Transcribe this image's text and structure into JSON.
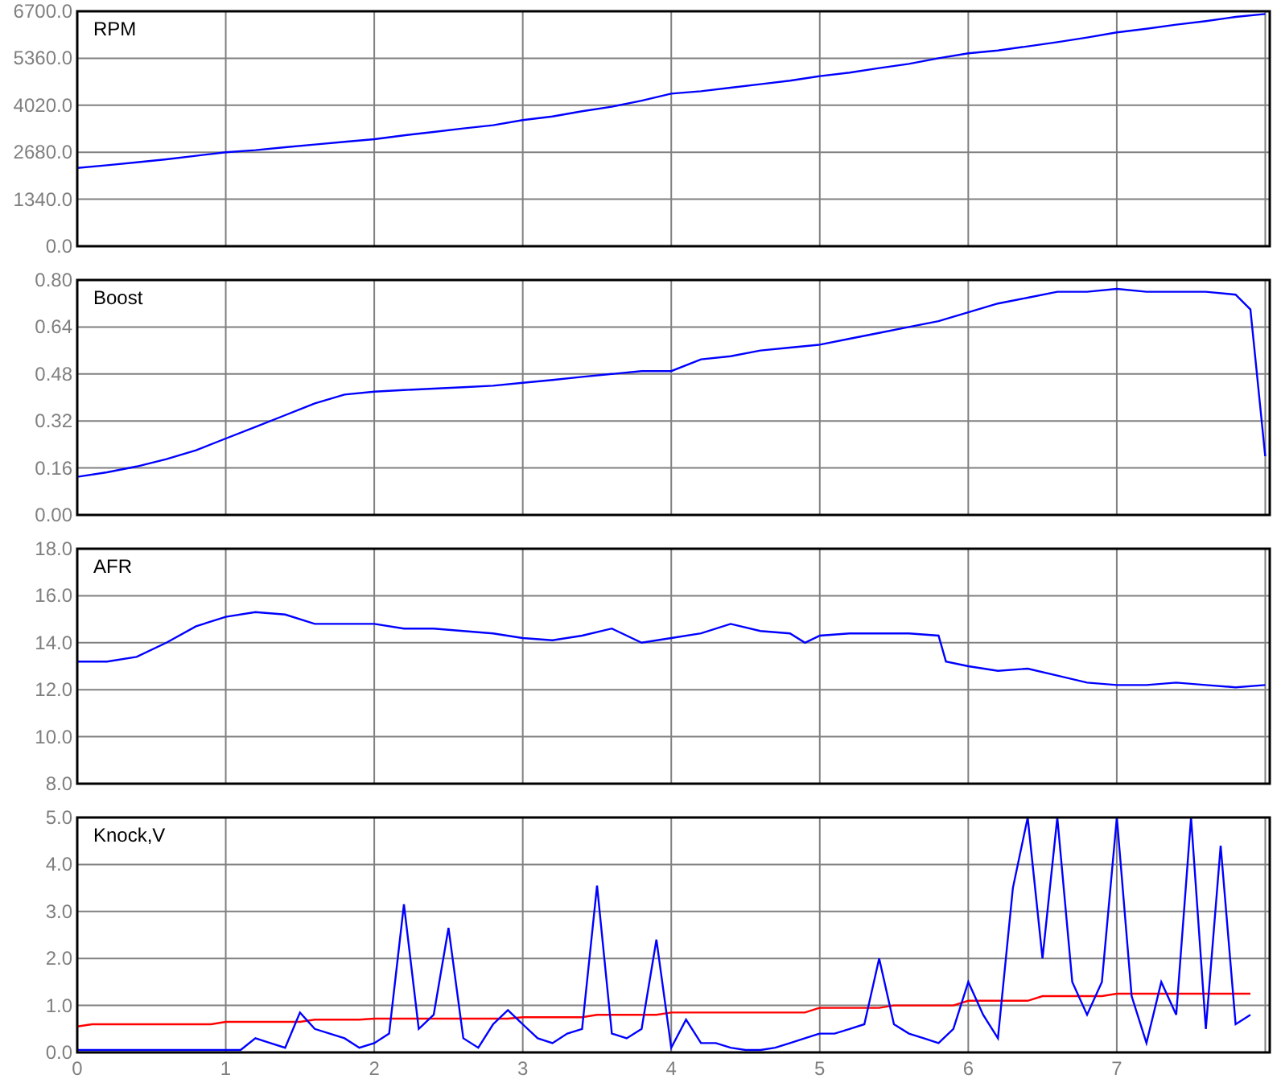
{
  "charts": [
    {
      "chart_data": {
        "type": "line",
        "title": "RPM",
        "grid": true,
        "xlim": [
          0,
          8.03
        ],
        "ylim": [
          0,
          6700
        ],
        "yticks": [
          {
            "value": 0,
            "label": "0.0"
          },
          {
            "value": 1340,
            "label": "1340.0"
          },
          {
            "value": 2680,
            "label": "2680.0"
          },
          {
            "value": 4020,
            "label": "4020.0"
          },
          {
            "value": 5360,
            "label": "5360.0"
          },
          {
            "value": 6700,
            "label": "6700.0"
          }
        ],
        "x": [
          0,
          0.2,
          0.4,
          0.6,
          0.8,
          1,
          1.2,
          1.4,
          1.6,
          1.8,
          2,
          2.2,
          2.4,
          2.6,
          2.8,
          3,
          3.2,
          3.4,
          3.6,
          3.8,
          4,
          4.2,
          4.4,
          4.6,
          4.8,
          5,
          5.2,
          5.4,
          5.6,
          5.8,
          6,
          6.2,
          6.4,
          6.6,
          6.8,
          7,
          7.2,
          7.4,
          7.6,
          7.8,
          8
        ],
        "series": [
          {
            "color": "#0000ff",
            "values": [
              2230,
              2310,
              2390,
              2480,
              2580,
              2680,
              2740,
              2820,
              2900,
              2980,
              3050,
              3160,
              3260,
              3360,
              3450,
              3600,
              3700,
              3850,
              3980,
              4150,
              4350,
              4420,
              4520,
              4620,
              4720,
              4850,
              4950,
              5080,
              5200,
              5360,
              5500,
              5580,
              5700,
              5820,
              5950,
              6100,
              6200,
              6320,
              6420,
              6540,
              6620
            ]
          }
        ]
      }
    },
    {
      "chart_data": {
        "type": "line",
        "title": "Boost",
        "grid": true,
        "xlim": [
          0,
          8.03
        ],
        "ylim": [
          0,
          0.8
        ],
        "yticks": [
          {
            "value": 0,
            "label": "0.00"
          },
          {
            "value": 0.16,
            "label": "0.16"
          },
          {
            "value": 0.32,
            "label": "0.32"
          },
          {
            "value": 0.48,
            "label": "0.48"
          },
          {
            "value": 0.64,
            "label": "0.64"
          },
          {
            "value": 0.8,
            "label": "0.80"
          }
        ],
        "x": [
          0,
          0.2,
          0.4,
          0.6,
          0.8,
          1,
          1.2,
          1.4,
          1.6,
          1.8,
          2,
          2.2,
          2.4,
          2.6,
          2.8,
          3,
          3.2,
          3.4,
          3.6,
          3.8,
          4,
          4.2,
          4.4,
          4.6,
          4.8,
          5,
          5.2,
          5.4,
          5.6,
          5.8,
          6,
          6.2,
          6.4,
          6.6,
          6.8,
          7,
          7.2,
          7.4,
          7.6,
          7.8,
          7.9,
          8
        ],
        "series": [
          {
            "color": "#0000ff",
            "values": [
              0.13,
              0.145,
              0.165,
              0.19,
              0.22,
              0.26,
              0.3,
              0.34,
              0.38,
              0.41,
              0.42,
              0.425,
              0.43,
              0.435,
              0.44,
              0.45,
              0.46,
              0.47,
              0.48,
              0.49,
              0.49,
              0.53,
              0.54,
              0.56,
              0.57,
              0.58,
              0.6,
              0.62,
              0.64,
              0.66,
              0.69,
              0.72,
              0.74,
              0.76,
              0.76,
              0.77,
              0.76,
              0.76,
              0.76,
              0.75,
              0.7,
              0.2
            ]
          }
        ]
      }
    },
    {
      "chart_data": {
        "type": "line",
        "title": "AFR",
        "grid": true,
        "xlim": [
          0,
          8.03
        ],
        "ylim": [
          8,
          18
        ],
        "yticks": [
          {
            "value": 8,
            "label": "8.0"
          },
          {
            "value": 10,
            "label": "10.0"
          },
          {
            "value": 12,
            "label": "12.0"
          },
          {
            "value": 14,
            "label": "14.0"
          },
          {
            "value": 16,
            "label": "16.0"
          },
          {
            "value": 18,
            "label": "18.0"
          }
        ],
        "x": [
          0,
          0.2,
          0.4,
          0.6,
          0.8,
          1,
          1.2,
          1.4,
          1.6,
          1.8,
          2,
          2.2,
          2.4,
          2.6,
          2.8,
          3,
          3.2,
          3.4,
          3.6,
          3.8,
          4,
          4.2,
          4.4,
          4.6,
          4.8,
          4.9,
          5,
          5.2,
          5.4,
          5.6,
          5.8,
          5.85,
          6,
          6.2,
          6.4,
          6.6,
          6.8,
          7,
          7.2,
          7.4,
          7.6,
          7.8,
          8
        ],
        "series": [
          {
            "color": "#0000ff",
            "values": [
              13.2,
              13.2,
              13.4,
              14,
              14.7,
              15.1,
              15.3,
              15.2,
              14.8,
              14.8,
              14.8,
              14.6,
              14.6,
              14.5,
              14.4,
              14.2,
              14.1,
              14.3,
              14.6,
              14,
              14.2,
              14.4,
              14.8,
              14.5,
              14.4,
              14,
              14.3,
              14.4,
              14.4,
              14.4,
              14.3,
              13.2,
              13,
              12.8,
              12.9,
              12.6,
              12.3,
              12.2,
              12.2,
              12.3,
              12.2,
              12.1,
              12.2
            ]
          }
        ]
      }
    },
    {
      "chart_data": {
        "type": "line",
        "title": "Knock,V",
        "grid": true,
        "xlim": [
          0,
          8.03
        ],
        "ylim": [
          0,
          5
        ],
        "xticks": [
          0,
          1,
          2,
          3,
          4,
          5,
          6,
          7
        ],
        "yticks": [
          {
            "value": 0,
            "label": "0.0"
          },
          {
            "value": 1,
            "label": "1.0"
          },
          {
            "value": 2,
            "label": "2.0"
          },
          {
            "value": 3,
            "label": "3.0"
          },
          {
            "value": 4,
            "label": "4.0"
          },
          {
            "value": 5,
            "label": "5.0"
          }
        ],
        "x": [
          0,
          0.1,
          0.2,
          0.3,
          0.4,
          0.5,
          0.6,
          0.7,
          0.8,
          0.9,
          1,
          1.1,
          1.2,
          1.3,
          1.4,
          1.5,
          1.6,
          1.7,
          1.8,
          1.9,
          2,
          2.1,
          2.2,
          2.3,
          2.4,
          2.5,
          2.6,
          2.7,
          2.8,
          2.9,
          3,
          3.1,
          3.2,
          3.3,
          3.4,
          3.5,
          3.6,
          3.7,
          3.8,
          3.9,
          4,
          4.1,
          4.2,
          4.3,
          4.4,
          4.5,
          4.6,
          4.7,
          4.8,
          4.9,
          5,
          5.1,
          5.2,
          5.3,
          5.4,
          5.5,
          5.6,
          5.7,
          5.8,
          5.9,
          6,
          6.1,
          6.2,
          6.3,
          6.4,
          6.5,
          6.6,
          6.7,
          6.8,
          6.9,
          7,
          7.1,
          7.2,
          7.3,
          7.4,
          7.5,
          7.6,
          7.7,
          7.8,
          7.9
        ],
        "series": [
          {
            "color": "#0000ff",
            "values": [
              0.05,
              0.05,
              0.05,
              0.05,
              0.05,
              0.05,
              0.05,
              0.05,
              0.05,
              0.05,
              0.05,
              0.05,
              0.3,
              0.2,
              0.1,
              0.85,
              0.5,
              0.4,
              0.3,
              0.1,
              0.2,
              0.4,
              3.15,
              0.5,
              0.8,
              2.65,
              0.3,
              0.1,
              0.6,
              0.9,
              0.6,
              0.3,
              0.2,
              0.4,
              0.5,
              3.55,
              0.4,
              0.3,
              0.5,
              2.4,
              0.1,
              0.7,
              0.2,
              0.2,
              0.1,
              0.05,
              0.05,
              0.1,
              0.2,
              0.3,
              0.4,
              0.4,
              0.5,
              0.6,
              2,
              0.6,
              0.4,
              0.3,
              0.2,
              0.5,
              1.5,
              0.8,
              0.3,
              3.5,
              5,
              2,
              5,
              1.5,
              0.8,
              1.5,
              5,
              1.2,
              0.2,
              1.5,
              0.8,
              5,
              0.5,
              4.4,
              0.6,
              0.8
            ]
          },
          {
            "color": "#ff0000",
            "values": [
              0.55,
              0.6,
              0.6,
              0.6,
              0.6,
              0.6,
              0.6,
              0.6,
              0.6,
              0.6,
              0.65,
              0.65,
              0.65,
              0.65,
              0.65,
              0.65,
              0.7,
              0.7,
              0.7,
              0.7,
              0.72,
              0.72,
              0.72,
              0.72,
              0.72,
              0.72,
              0.72,
              0.72,
              0.72,
              0.72,
              0.75,
              0.75,
              0.75,
              0.75,
              0.75,
              0.8,
              0.8,
              0.8,
              0.8,
              0.8,
              0.85,
              0.85,
              0.85,
              0.85,
              0.85,
              0.85,
              0.85,
              0.85,
              0.85,
              0.85,
              0.95,
              0.95,
              0.95,
              0.95,
              0.95,
              1,
              1,
              1,
              1,
              1,
              1.1,
              1.1,
              1.1,
              1.1,
              1.1,
              1.2,
              1.2,
              1.2,
              1.2,
              1.2,
              1.25,
              1.25,
              1.25,
              1.25,
              1.25,
              1.25,
              1.25,
              1.25,
              1.25,
              1.25
            ]
          }
        ]
      }
    }
  ]
}
